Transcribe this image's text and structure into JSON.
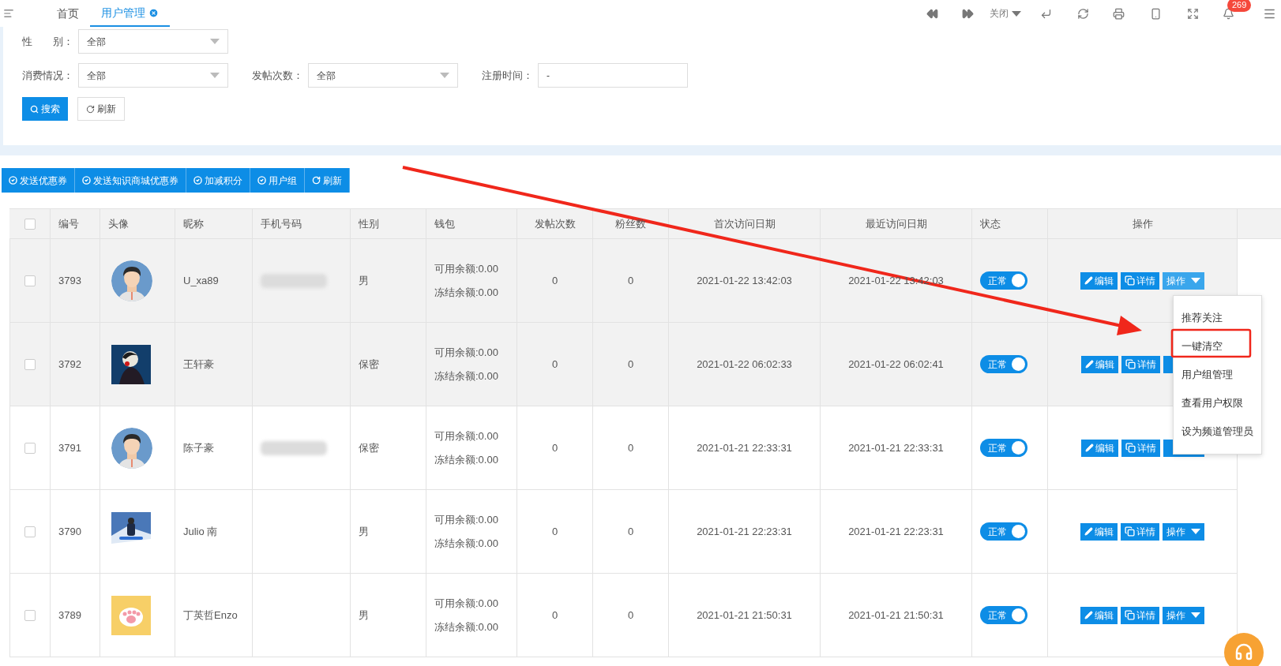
{
  "top_tabs": [
    {
      "label": "首页",
      "selected": false,
      "closable": false
    },
    {
      "label": "用户管理",
      "selected": true,
      "closable": true
    }
  ],
  "top_actions": {
    "close_label": "关闭",
    "notification_count": "269"
  },
  "filter_rows": [
    {
      "fields": [
        {
          "label": "性　　别：",
          "value": "全部",
          "kind": "select"
        }
      ]
    },
    {
      "fields": [
        {
          "label": "消费情况：",
          "value": "全部",
          "kind": "select"
        },
        {
          "label": "发帖次数：",
          "value": "全部",
          "kind": "select"
        },
        {
          "label": "注册时间：",
          "value": "-",
          "kind": "input"
        }
      ]
    }
  ],
  "filter_buttons": [
    {
      "label": "搜索",
      "kind": "primary"
    },
    {
      "label": "刷新",
      "kind": "default"
    }
  ],
  "toolbar": [
    {
      "label": "发送优惠券",
      "kind": "action"
    },
    {
      "label": "发送知识商城优惠券",
      "kind": "action"
    },
    {
      "label": "加减积分",
      "kind": "action"
    },
    {
      "label": "用户组",
      "kind": "action"
    },
    {
      "label": "刷新",
      "kind": "reload"
    }
  ],
  "table": {
    "select_all": {
      "checked": false
    },
    "columns": [
      "编号",
      "头像",
      "昵称",
      "手机号码",
      "性别",
      "钱包",
      "发帖次数",
      "粉丝数",
      "首次访问日期",
      "最近访问日期",
      "状态",
      "操作"
    ],
    "rows": [
      {
        "checked": false,
        "highlighted": true,
        "id": "3793",
        "nickname": "U_xa89",
        "phone_blurred": true,
        "gender": "男",
        "wallet": [
          "可用余额:0.00",
          "冻结余额:0.00"
        ],
        "posts": "0",
        "fans": "0",
        "first_visit": "2021-01-22 13:42:03",
        "last_visit": "2021-01-22 13:42:03",
        "status": {
          "label": "正常",
          "on": true
        },
        "actions": [
          "编辑",
          "详情",
          "操作"
        ],
        "menu_open": true
      },
      {
        "checked": false,
        "highlighted": true,
        "id": "3792",
        "nickname": "王轩豪",
        "phone_blurred": false,
        "gender": "保密",
        "wallet": [
          "可用余额:0.00",
          "冻结余额:0.00"
        ],
        "posts": "0",
        "fans": "0",
        "first_visit": "2021-01-22 06:02:33",
        "last_visit": "2021-01-22 06:02:41",
        "status": {
          "label": "正常",
          "on": true
        },
        "actions": [
          "编辑",
          "详情"
        ],
        "covered_button": true,
        "menu_open": false
      },
      {
        "checked": false,
        "highlighted": false,
        "id": "3791",
        "nickname": "陈子豪",
        "phone_blurred": true,
        "gender": "保密",
        "wallet": [
          "可用余额:0.00",
          "冻结余额:0.00"
        ],
        "posts": "0",
        "fans": "0",
        "first_visit": "2021-01-21 22:33:31",
        "last_visit": "2021-01-21 22:33:31",
        "status": {
          "label": "正常",
          "on": true
        },
        "actions": [
          "编辑",
          "详情"
        ],
        "covered_button": true,
        "menu_open": false
      },
      {
        "checked": false,
        "highlighted": false,
        "id": "3790",
        "nickname": "Julio 南",
        "phone_blurred": false,
        "gender": "男",
        "wallet": [
          "可用余额:0.00",
          "冻结余额:0.00"
        ],
        "posts": "0",
        "fans": "0",
        "first_visit": "2021-01-21 22:23:31",
        "last_visit": "2021-01-21 22:23:31",
        "status": {
          "label": "正常",
          "on": true
        },
        "actions": [
          "编辑",
          "详情",
          "操作"
        ],
        "menu_open": false
      },
      {
        "checked": false,
        "highlighted": false,
        "id": "3789",
        "nickname": "丁英哲Enzo",
        "phone_blurred": false,
        "gender": "男",
        "wallet": [
          "可用余额:0.00",
          "冻结余额:0.00"
        ],
        "posts": "0",
        "fans": "0",
        "first_visit": "2021-01-21 21:50:31",
        "last_visit": "2021-01-21 21:50:31",
        "status": {
          "label": "正常",
          "on": true
        },
        "actions": [
          "编辑",
          "详情",
          "操作"
        ],
        "menu_open": false
      }
    ]
  },
  "action_menu": [
    "推荐关注",
    "一键清空",
    "用户组管理",
    "查看用户权限",
    "设为频道管理员"
  ]
}
